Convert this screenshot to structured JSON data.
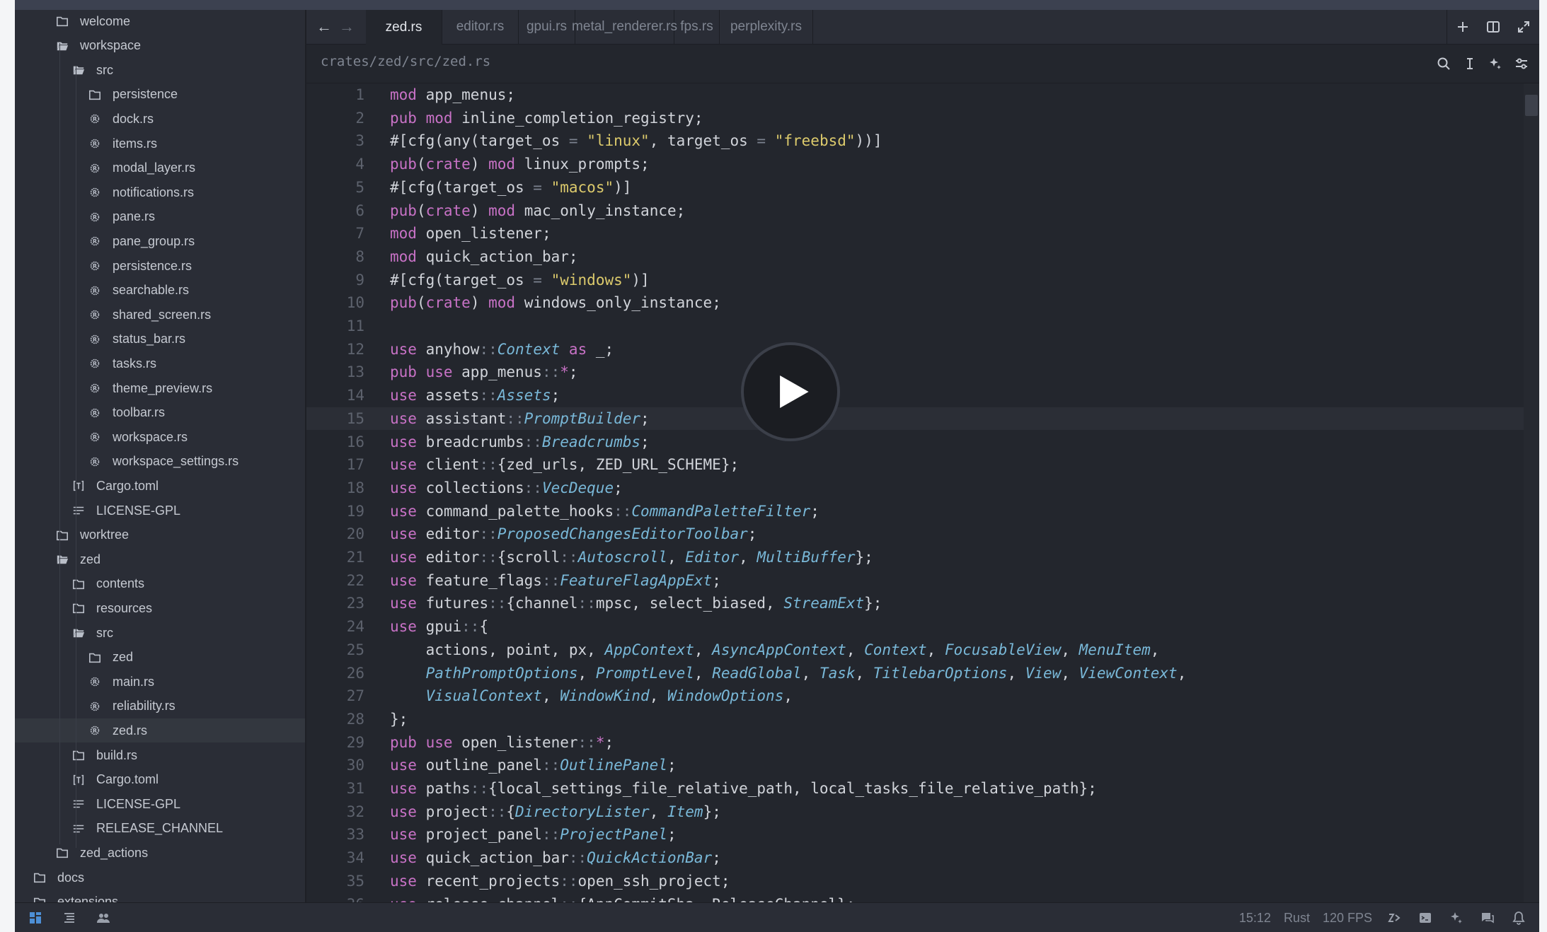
{
  "colors": {
    "background": "#23262d",
    "sidebar": "#2a2d36",
    "keyword": "#c872c6",
    "string": "#dcca6c",
    "type": "#79b8d8",
    "text": "#d1d4da"
  },
  "sidebar": {
    "items": [
      {
        "label": "welcome",
        "icon": "folder-icon",
        "depth": 0
      },
      {
        "label": "workspace",
        "icon": "folder-open-icon",
        "depth": 0
      },
      {
        "label": "src",
        "icon": "folder-open-icon",
        "depth": 1
      },
      {
        "label": "persistence",
        "icon": "folder-icon",
        "depth": 2
      },
      {
        "label": "dock.rs",
        "icon": "rust-file-icon",
        "depth": 2
      },
      {
        "label": "items.rs",
        "icon": "rust-file-icon",
        "depth": 2
      },
      {
        "label": "modal_layer.rs",
        "icon": "rust-file-icon",
        "depth": 2
      },
      {
        "label": "notifications.rs",
        "icon": "rust-file-icon",
        "depth": 2
      },
      {
        "label": "pane.rs",
        "icon": "rust-file-icon",
        "depth": 2
      },
      {
        "label": "pane_group.rs",
        "icon": "rust-file-icon",
        "depth": 2
      },
      {
        "label": "persistence.rs",
        "icon": "rust-file-icon",
        "depth": 2
      },
      {
        "label": "searchable.rs",
        "icon": "rust-file-icon",
        "depth": 2
      },
      {
        "label": "shared_screen.rs",
        "icon": "rust-file-icon",
        "depth": 2
      },
      {
        "label": "status_bar.rs",
        "icon": "rust-file-icon",
        "depth": 2
      },
      {
        "label": "tasks.rs",
        "icon": "rust-file-icon",
        "depth": 2
      },
      {
        "label": "theme_preview.rs",
        "icon": "rust-file-icon",
        "depth": 2
      },
      {
        "label": "toolbar.rs",
        "icon": "rust-file-icon",
        "depth": 2
      },
      {
        "label": "workspace.rs",
        "icon": "rust-file-icon",
        "depth": 2
      },
      {
        "label": "workspace_settings.rs",
        "icon": "rust-file-icon",
        "depth": 2
      },
      {
        "label": "Cargo.toml",
        "icon": "toml-file-icon",
        "depth": 1
      },
      {
        "label": "LICENSE-GPL",
        "icon": "text-file-icon",
        "depth": 1
      },
      {
        "label": "worktree",
        "icon": "folder-icon",
        "depth": 0
      },
      {
        "label": "zed",
        "icon": "folder-open-icon",
        "depth": 0
      },
      {
        "label": "contents",
        "icon": "folder-icon",
        "depth": 1
      },
      {
        "label": "resources",
        "icon": "folder-icon",
        "depth": 1
      },
      {
        "label": "src",
        "icon": "folder-open-icon",
        "depth": 1
      },
      {
        "label": "zed",
        "icon": "folder-icon",
        "depth": 2
      },
      {
        "label": "main.rs",
        "icon": "rust-file-icon",
        "depth": 2
      },
      {
        "label": "reliability.rs",
        "icon": "rust-file-icon",
        "depth": 2
      },
      {
        "label": "zed.rs",
        "icon": "rust-file-icon",
        "depth": 2,
        "selected": true
      },
      {
        "label": "build.rs",
        "icon": "folder-icon",
        "depth": 1
      },
      {
        "label": "Cargo.toml",
        "icon": "toml-file-icon",
        "depth": 1
      },
      {
        "label": "LICENSE-GPL",
        "icon": "text-file-icon",
        "depth": 1
      },
      {
        "label": "RELEASE_CHANNEL",
        "icon": "text-file-icon",
        "depth": 1
      },
      {
        "label": "zed_actions",
        "icon": "folder-icon",
        "depth": 0
      },
      {
        "label": "docs",
        "icon": "folder-icon",
        "depth": -1
      },
      {
        "label": "extensions",
        "icon": "folder-icon",
        "depth": -1
      }
    ]
  },
  "tabs": [
    {
      "label": "zed.rs",
      "active": true
    },
    {
      "label": "editor.rs"
    },
    {
      "label": "gpui.rs"
    },
    {
      "label": "metal_renderer.rs"
    },
    {
      "label": "fps.rs"
    },
    {
      "label": "perplexity.rs"
    }
  ],
  "breadcrumb": "crates/zed/src/zed.rs",
  "current_line": 15,
  "code_lines": [
    [
      [
        "kw",
        "mod"
      ],
      [
        "t",
        " app_menus;"
      ]
    ],
    [
      [
        "kw",
        "pub mod"
      ],
      [
        "t",
        " inline_completion_registry;"
      ]
    ],
    [
      [
        "t",
        "#[cfg(any(target_os "
      ],
      [
        "op",
        "="
      ],
      [
        "t",
        " "
      ],
      [
        "str",
        "\"linux\""
      ],
      [
        "t",
        ", target_os "
      ],
      [
        "op",
        "="
      ],
      [
        "t",
        " "
      ],
      [
        "str",
        "\"freebsd\""
      ],
      [
        "t",
        "))]"
      ]
    ],
    [
      [
        "kw",
        "pub"
      ],
      [
        "t",
        "("
      ],
      [
        "kw",
        "crate"
      ],
      [
        "t",
        ") "
      ],
      [
        "kw",
        "mod"
      ],
      [
        "t",
        " linux_prompts;"
      ]
    ],
    [
      [
        "t",
        "#[cfg(target_os "
      ],
      [
        "op",
        "="
      ],
      [
        "t",
        " "
      ],
      [
        "str",
        "\"macos\""
      ],
      [
        "t",
        ")]"
      ]
    ],
    [
      [
        "kw",
        "pub"
      ],
      [
        "t",
        "("
      ],
      [
        "kw",
        "crate"
      ],
      [
        "t",
        ") "
      ],
      [
        "kw",
        "mod"
      ],
      [
        "t",
        " mac_only_instance;"
      ]
    ],
    [
      [
        "kw",
        "mod"
      ],
      [
        "t",
        " open_listener;"
      ]
    ],
    [
      [
        "kw",
        "mod"
      ],
      [
        "t",
        " quick_action_bar;"
      ]
    ],
    [
      [
        "t",
        "#[cfg(target_os "
      ],
      [
        "op",
        "="
      ],
      [
        "t",
        " "
      ],
      [
        "str",
        "\"windows\""
      ],
      [
        "t",
        ")]"
      ]
    ],
    [
      [
        "kw",
        "pub"
      ],
      [
        "t",
        "("
      ],
      [
        "kw",
        "crate"
      ],
      [
        "t",
        ") "
      ],
      [
        "kw",
        "mod"
      ],
      [
        "t",
        " windows_only_instance;"
      ]
    ],
    [],
    [
      [
        "kw",
        "use"
      ],
      [
        "t",
        " anyhow"
      ],
      [
        "op",
        "::"
      ],
      [
        "ty",
        "Context"
      ],
      [
        "t",
        " "
      ],
      [
        "kw",
        "as"
      ],
      [
        "t",
        " _;"
      ]
    ],
    [
      [
        "kw",
        "pub use"
      ],
      [
        "t",
        " app_menus"
      ],
      [
        "op",
        "::"
      ],
      [
        "kw",
        "*"
      ],
      [
        "t",
        ";"
      ]
    ],
    [
      [
        "kw",
        "use"
      ],
      [
        "t",
        " assets"
      ],
      [
        "op",
        "::"
      ],
      [
        "ty",
        "Assets"
      ],
      [
        "t",
        ";"
      ]
    ],
    [
      [
        "kw",
        "use"
      ],
      [
        "t",
        " assistant"
      ],
      [
        "op",
        "::"
      ],
      [
        "ty",
        "PromptBuilder"
      ],
      [
        "t",
        ";"
      ]
    ],
    [
      [
        "kw",
        "use"
      ],
      [
        "t",
        " breadcrumbs"
      ],
      [
        "op",
        "::"
      ],
      [
        "ty",
        "Breadcrumbs"
      ],
      [
        "t",
        ";"
      ]
    ],
    [
      [
        "kw",
        "use"
      ],
      [
        "t",
        " client"
      ],
      [
        "op",
        "::"
      ],
      [
        "t",
        "{zed_urls, ZED_URL_SCHEME};"
      ]
    ],
    [
      [
        "kw",
        "use"
      ],
      [
        "t",
        " collections"
      ],
      [
        "op",
        "::"
      ],
      [
        "ty",
        "VecDeque"
      ],
      [
        "t",
        ";"
      ]
    ],
    [
      [
        "kw",
        "use"
      ],
      [
        "t",
        " command_palette_hooks"
      ],
      [
        "op",
        "::"
      ],
      [
        "ty",
        "CommandPaletteFilter"
      ],
      [
        "t",
        ";"
      ]
    ],
    [
      [
        "kw",
        "use"
      ],
      [
        "t",
        " editor"
      ],
      [
        "op",
        "::"
      ],
      [
        "ty",
        "ProposedChangesEditorToolbar"
      ],
      [
        "t",
        ";"
      ]
    ],
    [
      [
        "kw",
        "use"
      ],
      [
        "t",
        " editor"
      ],
      [
        "op",
        "::"
      ],
      [
        "t",
        "{scroll"
      ],
      [
        "op",
        "::"
      ],
      [
        "ty",
        "Autoscroll"
      ],
      [
        "t",
        ", "
      ],
      [
        "ty",
        "Editor"
      ],
      [
        "t",
        ", "
      ],
      [
        "ty",
        "MultiBuffer"
      ],
      [
        "t",
        "};"
      ]
    ],
    [
      [
        "kw",
        "use"
      ],
      [
        "t",
        " feature_flags"
      ],
      [
        "op",
        "::"
      ],
      [
        "ty",
        "FeatureFlagAppExt"
      ],
      [
        "t",
        ";"
      ]
    ],
    [
      [
        "kw",
        "use"
      ],
      [
        "t",
        " futures"
      ],
      [
        "op",
        "::"
      ],
      [
        "t",
        "{channel"
      ],
      [
        "op",
        "::"
      ],
      [
        "t",
        "mpsc, select_biased, "
      ],
      [
        "ty",
        "StreamExt"
      ],
      [
        "t",
        "};"
      ]
    ],
    [
      [
        "kw",
        "use"
      ],
      [
        "t",
        " gpui"
      ],
      [
        "op",
        "::"
      ],
      [
        "t",
        "{"
      ]
    ],
    [
      [
        "t",
        "    actions, point, px, "
      ],
      [
        "ty",
        "AppContext"
      ],
      [
        "t",
        ", "
      ],
      [
        "ty",
        "AsyncAppContext"
      ],
      [
        "t",
        ", "
      ],
      [
        "ty",
        "Context"
      ],
      [
        "t",
        ", "
      ],
      [
        "ty",
        "FocusableView"
      ],
      [
        "t",
        ", "
      ],
      [
        "ty",
        "MenuItem"
      ],
      [
        "t",
        ","
      ]
    ],
    [
      [
        "t",
        "    "
      ],
      [
        "ty",
        "PathPromptOptions"
      ],
      [
        "t",
        ", "
      ],
      [
        "ty",
        "PromptLevel"
      ],
      [
        "t",
        ", "
      ],
      [
        "ty",
        "ReadGlobal"
      ],
      [
        "t",
        ", "
      ],
      [
        "ty",
        "Task"
      ],
      [
        "t",
        ", "
      ],
      [
        "ty",
        "TitlebarOptions"
      ],
      [
        "t",
        ", "
      ],
      [
        "ty",
        "View"
      ],
      [
        "t",
        ", "
      ],
      [
        "ty",
        "ViewContext"
      ],
      [
        "t",
        ","
      ]
    ],
    [
      [
        "t",
        "    "
      ],
      [
        "ty",
        "VisualContext"
      ],
      [
        "t",
        ", "
      ],
      [
        "ty",
        "WindowKind"
      ],
      [
        "t",
        ", "
      ],
      [
        "ty",
        "WindowOptions"
      ],
      [
        "t",
        ","
      ]
    ],
    [
      [
        "t",
        "};"
      ]
    ],
    [
      [
        "kw",
        "pub use"
      ],
      [
        "t",
        " open_listener"
      ],
      [
        "op",
        "::"
      ],
      [
        "kw",
        "*"
      ],
      [
        "t",
        ";"
      ]
    ],
    [
      [
        "kw",
        "use"
      ],
      [
        "t",
        " outline_panel"
      ],
      [
        "op",
        "::"
      ],
      [
        "ty",
        "OutlinePanel"
      ],
      [
        "t",
        ";"
      ]
    ],
    [
      [
        "kw",
        "use"
      ],
      [
        "t",
        " paths"
      ],
      [
        "op",
        "::"
      ],
      [
        "t",
        "{local_settings_file_relative_path, local_tasks_file_relative_path};"
      ]
    ],
    [
      [
        "kw",
        "use"
      ],
      [
        "t",
        " project"
      ],
      [
        "op",
        "::"
      ],
      [
        "t",
        "{"
      ],
      [
        "ty",
        "DirectoryLister"
      ],
      [
        "t",
        ", "
      ],
      [
        "ty",
        "Item"
      ],
      [
        "t",
        "};"
      ]
    ],
    [
      [
        "kw",
        "use"
      ],
      [
        "t",
        " project_panel"
      ],
      [
        "op",
        "::"
      ],
      [
        "ty",
        "ProjectPanel"
      ],
      [
        "t",
        ";"
      ]
    ],
    [
      [
        "kw",
        "use"
      ],
      [
        "t",
        " quick_action_bar"
      ],
      [
        "op",
        "::"
      ],
      [
        "ty",
        "QuickActionBar"
      ],
      [
        "t",
        ";"
      ]
    ],
    [
      [
        "kw",
        "use"
      ],
      [
        "t",
        " recent_projects"
      ],
      [
        "op",
        "::"
      ],
      [
        "t",
        "open_ssh_project;"
      ]
    ],
    [
      [
        "kw",
        "use"
      ],
      [
        "t",
        " release_channel"
      ],
      [
        "op",
        "::"
      ],
      [
        "t",
        "{AppCommitSha, ReleaseChannel};"
      ]
    ]
  ],
  "status": {
    "cursor": "15:12",
    "language": "Rust",
    "fps": "120 FPS"
  }
}
